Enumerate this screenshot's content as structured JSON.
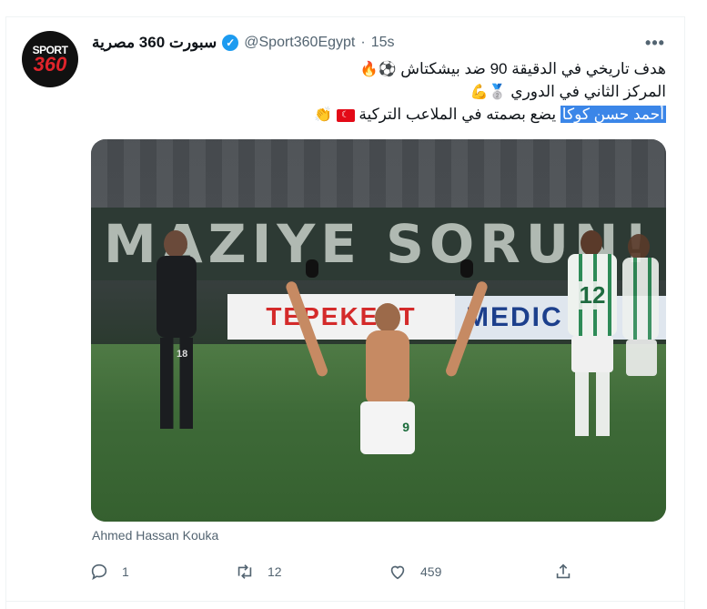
{
  "tweet": {
    "avatar": {
      "line1": "SPORT",
      "line2": "360"
    },
    "display_name": "سبورت 360 مصرية",
    "handle": "@Sport360Egypt",
    "separator": "·",
    "time": "15s",
    "more_icon": "more-horizontal-icon",
    "text_lines": {
      "line1": "هدف تاريخي  في الدقيقة 90 ضد بيشكتاش",
      "line1_emojis": "⚽🔥",
      "line2": "المركز الثاني في الدوري",
      "line2_emojis": "🥈💪",
      "line3_highlight": "أحمد حسن كوكا",
      "line3_rest": " يضع بصمته في الملاعب التركية",
      "line3_flag": "☾",
      "line3_emojis": "👏"
    },
    "photo": {
      "banner_text": "MAZIYE SORUN!",
      "adboard_left": "TEPEKENT",
      "adboard_right": "MEDIC",
      "main_player_shorts": "9",
      "black_player_number": "18",
      "green_player_number": "12"
    },
    "alt_caption": "Ahmed Hassan Kouka",
    "actions": {
      "reply_count": "1",
      "retweet_count": "12",
      "like_count": "459"
    },
    "colors": {
      "verified": "#1d9bf0",
      "highlight": "#3b86e8",
      "muted": "#536471"
    }
  }
}
